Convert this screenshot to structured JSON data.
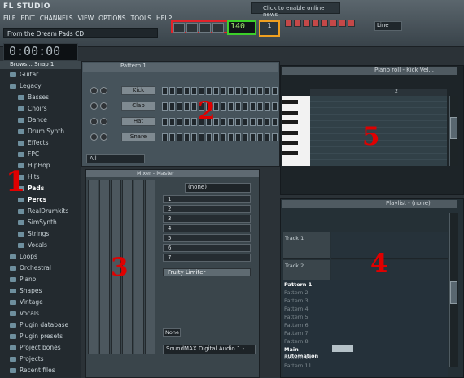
{
  "app": {
    "logo": "FL STUDIO",
    "menu": [
      "FILE",
      "EDIT",
      "CHANNELS",
      "VIEW",
      "OPTIONS",
      "TOOLS",
      "HELP"
    ],
    "hint": "From the Dream Pads CD",
    "clock": "0:00:00",
    "news": "Click to enable online news",
    "select": "Line"
  },
  "browser": {
    "header": "Brows...  Snap 1",
    "items": [
      "Guitar",
      "Legacy",
      "Basses",
      "Choirs",
      "Dance",
      "Drum Synth",
      "Effects",
      "FPC",
      "HipHop",
      "Hits",
      "Pads",
      "Percs",
      "RealDrumkits",
      "SimSynth",
      "Strings",
      "Vocals",
      "Loops",
      "Orchestral",
      "Piano",
      "Shapes",
      "Vintage",
      "Vocals",
      "Plugin database",
      "Plugin presets",
      "Project bones",
      "Projects",
      "Recent files"
    ]
  },
  "channel_rack": {
    "title": "Pattern 1",
    "channels": [
      "Kick",
      "Clap",
      "Hat",
      "Snare"
    ],
    "filter": "All"
  },
  "mixer": {
    "title": "Mixer - Master",
    "none": "(none)",
    "fx": "Fruity Limiter",
    "none2": "None",
    "output": "SoundMAX Digital Audio 1 -"
  },
  "piano_roll": {
    "title": "Piano roll - Kick  Vel...",
    "ruler": "2"
  },
  "playlist": {
    "title": "Playlist - (none)",
    "tracks": [
      "Track 1",
      "Track 2"
    ],
    "patterns": [
      "Pattern 1",
      "Pattern 2",
      "Pattern 3",
      "Pattern 4",
      "Pattern 5",
      "Pattern 6",
      "Pattern 7",
      "Pattern 8",
      "Main automation",
      "Pattern 10",
      "Pattern 11"
    ]
  },
  "labels": {
    "one": "1",
    "two": "2",
    "three": "3",
    "four": "4",
    "five": "5"
  }
}
